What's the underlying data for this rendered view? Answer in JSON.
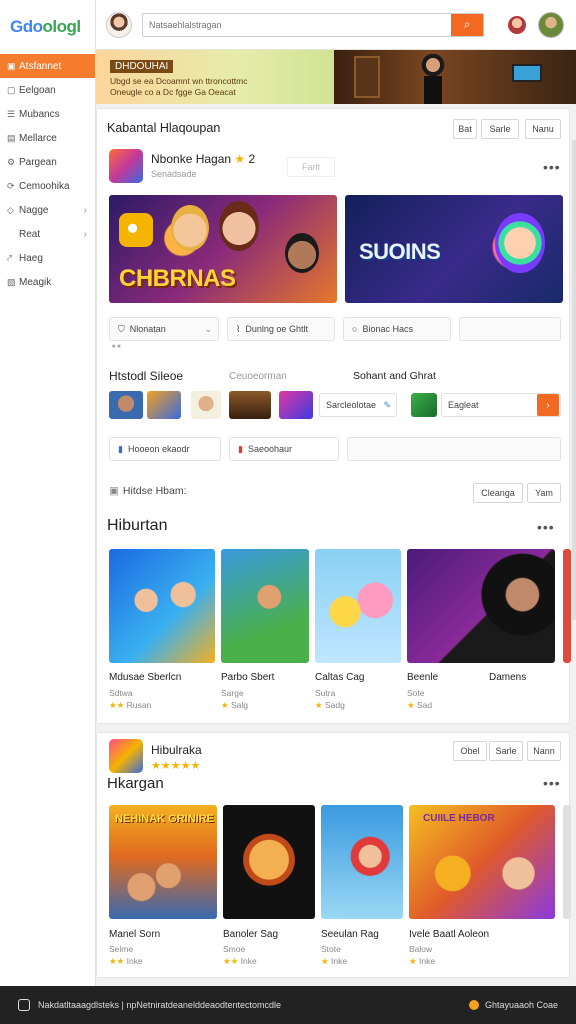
{
  "sidebar": {
    "logo": {
      "part1": "Gdo",
      "part2": "ologl"
    },
    "items": [
      {
        "label": "Atsfannet",
        "icon": "home-icon",
        "glyph": "▣",
        "active": true
      },
      {
        "label": "Eelgoan",
        "icon": "grid-icon",
        "glyph": "▢"
      },
      {
        "label": "Mubancs",
        "icon": "list-icon",
        "glyph": "☰"
      },
      {
        "label": "Mellarce",
        "icon": "document-icon",
        "glyph": "▤"
      },
      {
        "label": "Pargean",
        "icon": "gear-icon",
        "glyph": "⚙"
      },
      {
        "label": "Cemoohika",
        "icon": "share-icon",
        "glyph": "⟳"
      },
      {
        "label": "Nagge",
        "icon": "tag-icon",
        "glyph": "◇",
        "chevron": true
      },
      {
        "label": "Reat",
        "icon": "",
        "glyph": "",
        "chevron": true
      },
      {
        "label": "Haeg",
        "icon": "link-icon",
        "glyph": "⤤"
      },
      {
        "label": "Meagik",
        "icon": "image-icon",
        "glyph": "▧"
      }
    ]
  },
  "topbar": {
    "search_placeholder": "Natsaehlalstragan"
  },
  "banner": {
    "title": "DHDOUHAI",
    "line1": "Ubgd se ea Dcoamnt wn ttroncottmc",
    "line2": "Oneugle co a Dc fgge Ga Oeacat"
  },
  "card1": {
    "title": "Kabantal Hlaqoupan",
    "buttons": [
      "Bat",
      "Sarle",
      "Nanu"
    ],
    "app": {
      "name": "Nbonke Hagan",
      "rating": "2",
      "sub": "Senadsade",
      "action": "Farlt"
    },
    "hero": [
      {
        "label": "CHBRNAS"
      },
      {
        "label": "SUOINS"
      }
    ],
    "chips": [
      "Nlonatan",
      "Dunlng oe Ghtlt",
      "Bionac Hacs"
    ],
    "rating_row": "★★",
    "section": {
      "title": "Htstodl Sileoe",
      "mid": "Ceuoeorman",
      "right": "Sohant and Ghrat",
      "field1": "Sarcleolotae",
      "field2": "Eagleat",
      "go": "›"
    },
    "tags": [
      "Hooeon ekaodr",
      "Saeoohaur"
    ],
    "subheader": {
      "label": "Hitdse Hbam:",
      "buttons": [
        "Cleanga",
        "Yam"
      ]
    },
    "games_title": "Hiburtan",
    "games": [
      {
        "name": "Mdusae Sberlcn",
        "meta1": "Sdtwa",
        "stars": "★★",
        "meta2": "Rusan"
      },
      {
        "name": "Parbo Sbert",
        "meta1": "Sarge",
        "stars": "★",
        "meta2": "Salg"
      },
      {
        "name": "Caltas Cag",
        "meta1": "Sutra",
        "stars": "★",
        "meta2": "Sadg"
      },
      {
        "name": "Beenle",
        "meta1": "Sote",
        "stars": "★",
        "meta2": "Sad"
      },
      {
        "name": "Damens",
        "meta1": "",
        "stars": "",
        "meta2": ""
      }
    ]
  },
  "card2": {
    "app_name": "Hibulraka",
    "rating": "★★★★★",
    "title": "Hkargan",
    "buttons": [
      "Obel",
      "Sarle",
      "Nann"
    ],
    "games": [
      {
        "name": "Manel Sorn",
        "meta1": "Selme",
        "stars": "★★",
        "meta2": "Inke"
      },
      {
        "name": "Banoler Sag",
        "meta1": "Smoe",
        "stars": "★★",
        "meta2": "Inke"
      },
      {
        "name": "Seeulan Rag",
        "meta1": "Stote",
        "stars": "★",
        "meta2": "Inke"
      },
      {
        "name": "Ivele Baatl Aoleon",
        "meta1": "Balow",
        "stars": "★",
        "meta2": "Inke"
      }
    ],
    "game_overlays": [
      "NEHINAK GRINIRE",
      "CUIILE HEBOR"
    ]
  },
  "footer": {
    "left": "Nakdatltaaagdlsteks | npNetniratdeanelddeaodtentectomcdle",
    "right": "Ghtayuaaoh Coae"
  },
  "colors": {
    "accent": "#f26a21",
    "star": "#f4b400"
  }
}
